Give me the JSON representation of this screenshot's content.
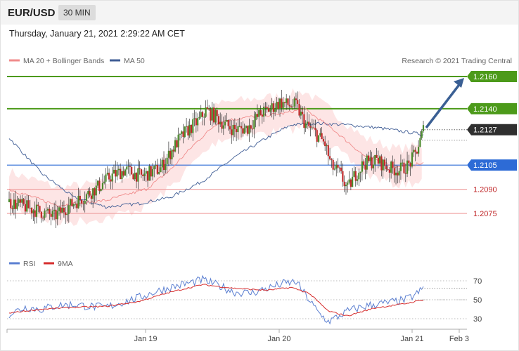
{
  "header": {
    "symbol": "EUR/USD",
    "timeframe": "30 MIN",
    "datetime": "Thursday, January 21, 2021 2:29:22 AM CET"
  },
  "legend": {
    "ma20_label": "MA 20 + Bollinger Bands",
    "ma50_label": "MA 50",
    "credit": "Research © 2021 Trading Central",
    "rsi_label": "RSI",
    "rsi_ma_label": "9MA"
  },
  "colors": {
    "ma20": "#f08b8b",
    "ma50": "#3f5d95",
    "band_fill": "#fde0e0",
    "bull_candle": "#4a8a2a",
    "bear_candle": "#c0282a",
    "resistance": "#4c9a1a",
    "pivot": "#2d6bd6",
    "support": "#f0a3a3",
    "current": "#333333",
    "arrow": "#3a5f94",
    "rsi": "#5b7fd1",
    "rsi_ma": "#d62d2d"
  },
  "chart_data": {
    "type": "candlestick",
    "price_axis": {
      "ylim": [
        2.206,
        1.2166
      ]
    },
    "levels": [
      {
        "label": "1.2160",
        "value": 1.216,
        "kind": "resistance"
      },
      {
        "label": "1.2140",
        "value": 1.214,
        "kind": "resistance"
      },
      {
        "label": "1.2127",
        "value": 1.2127,
        "kind": "current"
      },
      {
        "label": "1.2105",
        "value": 1.2105,
        "kind": "pivot"
      },
      {
        "label": "1.2090",
        "value": 1.209,
        "kind": "support"
      },
      {
        "label": "1.2075",
        "value": 1.2075,
        "kind": "support"
      }
    ],
    "x_ticks": [
      "Jan 19",
      "Jan 20",
      "Jan 21",
      "Feb 3"
    ],
    "rsi_levels": [
      70,
      50,
      30
    ],
    "price_path": [
      [
        0,
        1.2082
      ],
      [
        10,
        1.2079
      ],
      [
        20,
        1.2076
      ],
      [
        28,
        1.2073
      ],
      [
        36,
        1.2079
      ],
      [
        46,
        1.2085
      ],
      [
        56,
        1.2092
      ],
      [
        63,
        1.2098
      ],
      [
        72,
        1.2102
      ],
      [
        82,
        1.2098
      ],
      [
        94,
        1.2103
      ],
      [
        104,
        1.2119
      ],
      [
        110,
        1.2126
      ],
      [
        118,
        1.2133
      ],
      [
        122,
        1.2139
      ],
      [
        128,
        1.2135
      ],
      [
        134,
        1.213
      ],
      [
        140,
        1.2127
      ],
      [
        148,
        1.2128
      ],
      [
        156,
        1.2137
      ],
      [
        162,
        1.214
      ],
      [
        168,
        1.2144
      ],
      [
        174,
        1.2142
      ],
      [
        178,
        1.2142
      ],
      [
        184,
        1.213
      ],
      [
        190,
        1.2125
      ],
      [
        196,
        1.2118
      ],
      [
        200,
        1.2104
      ],
      [
        205,
        1.21
      ],
      [
        210,
        1.209
      ],
      [
        214,
        1.2098
      ],
      [
        220,
        1.2106
      ],
      [
        228,
        1.2108
      ],
      [
        236,
        1.2103
      ],
      [
        242,
        1.2102
      ],
      [
        248,
        1.2105
      ],
      [
        252,
        1.2112
      ],
      [
        255,
        1.212
      ],
      [
        257,
        1.2127
      ]
    ],
    "ma20_path": [
      [
        0,
        1.209
      ],
      [
        30,
        1.208
      ],
      [
        60,
        1.2083
      ],
      [
        85,
        1.209
      ],
      [
        100,
        1.2102
      ],
      [
        115,
        1.2118
      ],
      [
        130,
        1.2132
      ],
      [
        150,
        1.2135
      ],
      [
        170,
        1.2137
      ],
      [
        183,
        1.214
      ],
      [
        200,
        1.2128
      ],
      [
        220,
        1.2111
      ],
      [
        240,
        1.2104
      ],
      [
        257,
        1.2106
      ]
    ],
    "ma50_path": [
      [
        0,
        1.2122
      ],
      [
        20,
        1.21
      ],
      [
        40,
        1.2085
      ],
      [
        60,
        1.2079
      ],
      [
        80,
        1.2081
      ],
      [
        100,
        1.2085
      ],
      [
        120,
        1.2095
      ],
      [
        140,
        1.211
      ],
      [
        160,
        1.2122
      ],
      [
        175,
        1.213
      ],
      [
        190,
        1.2131
      ],
      [
        210,
        1.213
      ],
      [
        230,
        1.2128
      ],
      [
        257,
        1.2124
      ]
    ],
    "band_width": 0.0011,
    "rsi_path": [
      [
        0,
        35
      ],
      [
        10,
        42
      ],
      [
        20,
        40
      ],
      [
        30,
        44
      ],
      [
        40,
        45
      ],
      [
        50,
        43
      ],
      [
        60,
        42
      ],
      [
        70,
        47
      ],
      [
        80,
        52
      ],
      [
        90,
        58
      ],
      [
        100,
        63
      ],
      [
        110,
        67
      ],
      [
        120,
        71
      ],
      [
        130,
        65
      ],
      [
        140,
        58
      ],
      [
        150,
        57
      ],
      [
        160,
        62
      ],
      [
        170,
        67
      ],
      [
        178,
        69
      ],
      [
        186,
        50
      ],
      [
        192,
        36
      ],
      [
        198,
        27
      ],
      [
        204,
        32
      ],
      [
        210,
        38
      ],
      [
        218,
        42
      ],
      [
        226,
        45
      ],
      [
        236,
        47
      ],
      [
        246,
        50
      ],
      [
        252,
        55
      ],
      [
        257,
        62
      ]
    ],
    "rsi_ma_path": [
      [
        0,
        36
      ],
      [
        20,
        40
      ],
      [
        40,
        42
      ],
      [
        60,
        43
      ],
      [
        80,
        48
      ],
      [
        100,
        58
      ],
      [
        120,
        66
      ],
      [
        140,
        62
      ],
      [
        160,
        60
      ],
      [
        175,
        63
      ],
      [
        186,
        57
      ],
      [
        198,
        38
      ],
      [
        210,
        33
      ],
      [
        226,
        41
      ],
      [
        246,
        46
      ],
      [
        257,
        50
      ]
    ]
  }
}
